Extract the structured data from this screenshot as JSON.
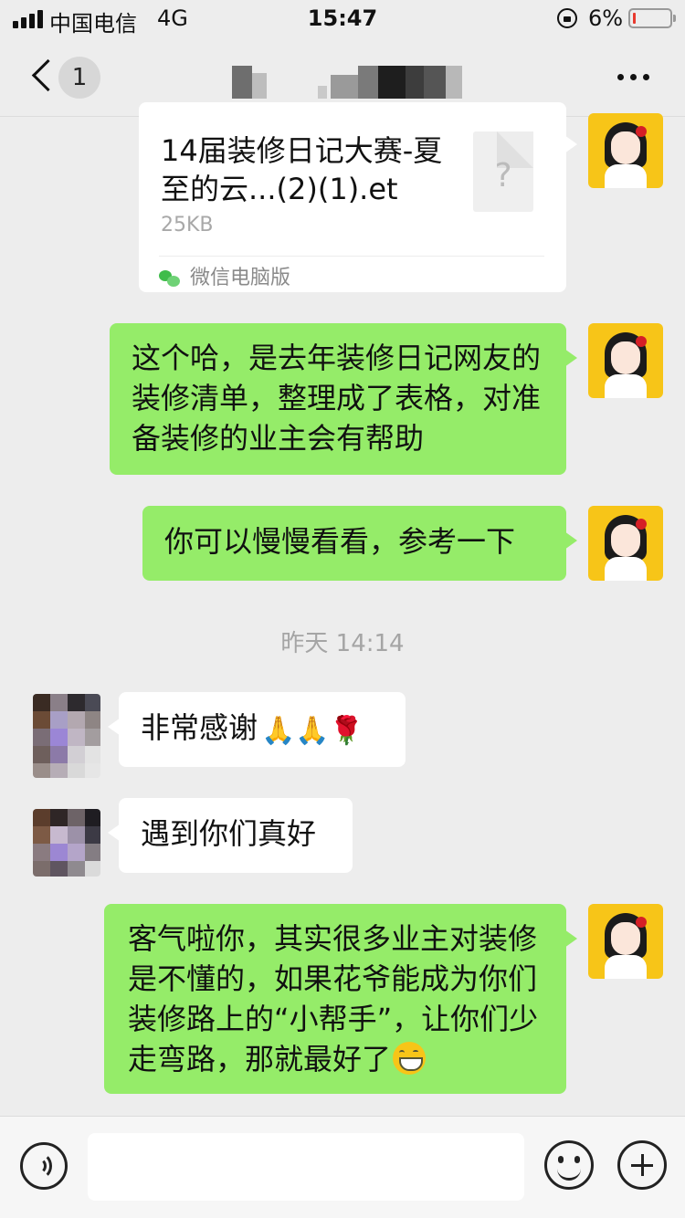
{
  "status_bar": {
    "carrier": "中国电信",
    "network": "4G",
    "time": "15:47",
    "battery_percent": "6%",
    "battery_level": 0.06,
    "battery_color": "#e83a2f"
  },
  "nav": {
    "unread_count": "1",
    "title_icon": "pixelated-contact-name",
    "more_icon": "ellipsis-icon"
  },
  "messages": {
    "file": {
      "name": "14届装修日记大赛-夏至的云...(2)(1).et",
      "size": "25KB",
      "source": "微信电脑版",
      "icon": "unknown-file-icon"
    },
    "msg1": "这个哈，是去年装修日记网友的装修清单，整理成了表格，对准备装修的业主会有帮助",
    "msg2": "你可以慢慢看看，参考一下",
    "timestamp": "昨天 14:14",
    "msg3": "非常感谢",
    "msg3_emojis": "🙏🙏🌹",
    "msg4": "遇到你们真好",
    "msg5": "客气啦你，其实很多业主对装修是不懂的，如果花爷能成为你们装修路上的“小帮手”，让你们少走弯路，那就最好了",
    "msg5_emoji": "grin-emoji"
  },
  "colors": {
    "background": "#ededed",
    "bubble_self": "#95ec69",
    "bubble_other": "#ffffff",
    "avatar_bg": "#f7c518"
  }
}
